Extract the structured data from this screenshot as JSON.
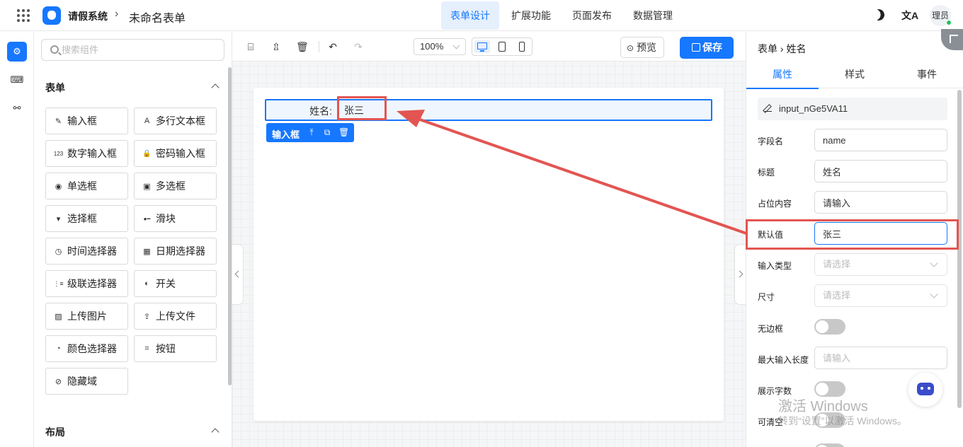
{
  "header": {
    "app_title": "请假系统",
    "crumb_sep": "›",
    "form_name": "未命名表单",
    "nav": [
      {
        "label": "表单设计",
        "active": true
      },
      {
        "label": "扩展功能",
        "active": false
      },
      {
        "label": "页面发布",
        "active": false
      },
      {
        "label": "数据管理",
        "active": false
      }
    ],
    "translate_glyph": "文A",
    "avatar_text": "理员"
  },
  "component_panel": {
    "search_placeholder": "搜索组件",
    "form_section": "表单",
    "layout_section": "布局",
    "components": [
      {
        "label": "输入框",
        "icon": "pencil-icon",
        "glyph": "✎"
      },
      {
        "label": "多行文本框",
        "icon": "textarea-icon",
        "glyph": "A"
      },
      {
        "label": "数字输入框",
        "icon": "number-icon",
        "glyph": "123"
      },
      {
        "label": "密码输入框",
        "icon": "lock-icon",
        "glyph": "🔒"
      },
      {
        "label": "单选框",
        "icon": "radio-icon",
        "glyph": "◉"
      },
      {
        "label": "多选框",
        "icon": "checkbox-icon",
        "glyph": "▣"
      },
      {
        "label": "选择框",
        "icon": "select-icon",
        "glyph": "▾"
      },
      {
        "label": "滑块",
        "icon": "slider-icon",
        "glyph": "●━"
      },
      {
        "label": "时间选择器",
        "icon": "clock-icon",
        "glyph": "◷"
      },
      {
        "label": "日期选择器",
        "icon": "calendar-icon",
        "glyph": "▦"
      },
      {
        "label": "级联选择器",
        "icon": "cascader-icon",
        "glyph": "⋮≡"
      },
      {
        "label": "开关",
        "icon": "switch-icon",
        "glyph": "◐"
      },
      {
        "label": "上传图片",
        "icon": "image-icon",
        "glyph": "▨"
      },
      {
        "label": "上传文件",
        "icon": "upload-icon",
        "glyph": "⇪"
      },
      {
        "label": "颜色选择器",
        "icon": "palette-icon",
        "glyph": "◔"
      },
      {
        "label": "按钮",
        "icon": "button-icon",
        "glyph": "⌗"
      },
      {
        "label": "隐藏域",
        "icon": "eye-off-icon",
        "glyph": "⊘"
      }
    ]
  },
  "toolbar": {
    "zoom": "100%",
    "preview_label": "预览",
    "save_label": "保存"
  },
  "canvas": {
    "field_label": "姓名:",
    "field_value": "张三",
    "selected_tag": "输入框"
  },
  "properties": {
    "crumb": "表单 › 姓名",
    "tabs": [
      {
        "label": "属性",
        "active": true
      },
      {
        "label": "样式",
        "active": false
      },
      {
        "label": "事件",
        "active": false
      }
    ],
    "component_id": "input_nGe5VA11",
    "field_name_label": "字段名",
    "field_name_value": "name",
    "title_label": "标题",
    "title_value": "姓名",
    "placeholder_label": "占位内容",
    "placeholder_value": "请输入",
    "default_label": "默认值",
    "default_value": "张三",
    "input_type_label": "输入类型",
    "input_type_placeholder": "请选择",
    "size_label": "尺寸",
    "size_placeholder": "请选择",
    "borderless_label": "无边框",
    "borderless_on": false,
    "maxlength_label": "最大输入长度",
    "maxlength_placeholder": "请输入",
    "show_count_label": "展示字数",
    "show_count_on": false,
    "clearable_label": "可清空",
    "clearable_on": false
  },
  "watermark": {
    "line1": "激活 Windows",
    "line2": "转到“设置”以激活 Windows。"
  },
  "colors": {
    "accent": "#1677ff",
    "annotation": "#e35552"
  }
}
